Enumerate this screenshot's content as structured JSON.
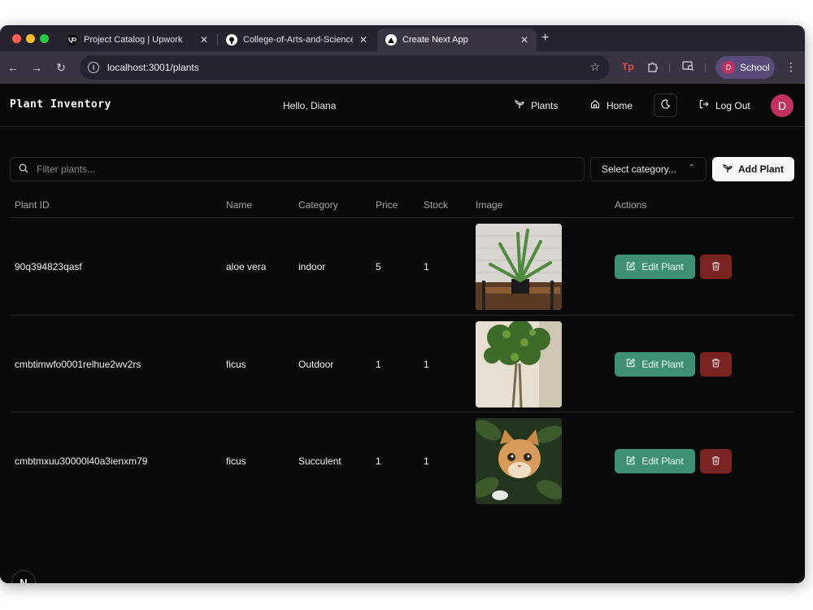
{
  "browser": {
    "tabs": [
      {
        "title": "Project Catalog | Upwork",
        "icon": "upwork-icon",
        "active": false
      },
      {
        "title": "College-of-Arts-and-Science",
        "icon": "github-icon",
        "active": false
      },
      {
        "title": "Create Next App",
        "icon": "nextjs-icon",
        "active": true
      }
    ],
    "url": "localhost:3001/plants",
    "profile": {
      "initial": "D",
      "label": "School"
    }
  },
  "app": {
    "brand": "Plant Inventory",
    "greeting": "Hello, Diana",
    "nav": {
      "plants": "Plants",
      "home": "Home",
      "logout": "Log Out"
    },
    "avatar_initial": "D"
  },
  "controls": {
    "filter_placeholder": "Filter plants...",
    "category_select": "Select category...",
    "add_label": "Add Plant"
  },
  "table": {
    "headers": [
      "Plant ID",
      "Name",
      "Category",
      "Price",
      "Stock",
      "Image",
      "Actions"
    ],
    "rows": [
      {
        "id": "90q394823qasf",
        "name": "aloe vera",
        "category": "indoor",
        "price": "5",
        "stock": "1",
        "image": "aloe-vera-photo"
      },
      {
        "id": "cmbtimwfo0001relhue2wv2rs",
        "name": "ficus",
        "category": "Outdoor",
        "price": "1",
        "stock": "1",
        "image": "ficus-tree-photo"
      },
      {
        "id": "cmbtmxuu30000l40a3ienxm79",
        "name": "ficus",
        "category": "Succulent",
        "price": "1",
        "stock": "1",
        "image": "cat-in-plants-photo"
      }
    ],
    "edit_label": "Edit Plant"
  },
  "colors": {
    "edit_button": "#3f8f72",
    "delete_button": "#7a2424",
    "avatar": "#c0335e",
    "background": "#0a0a0a"
  },
  "badge": "N"
}
